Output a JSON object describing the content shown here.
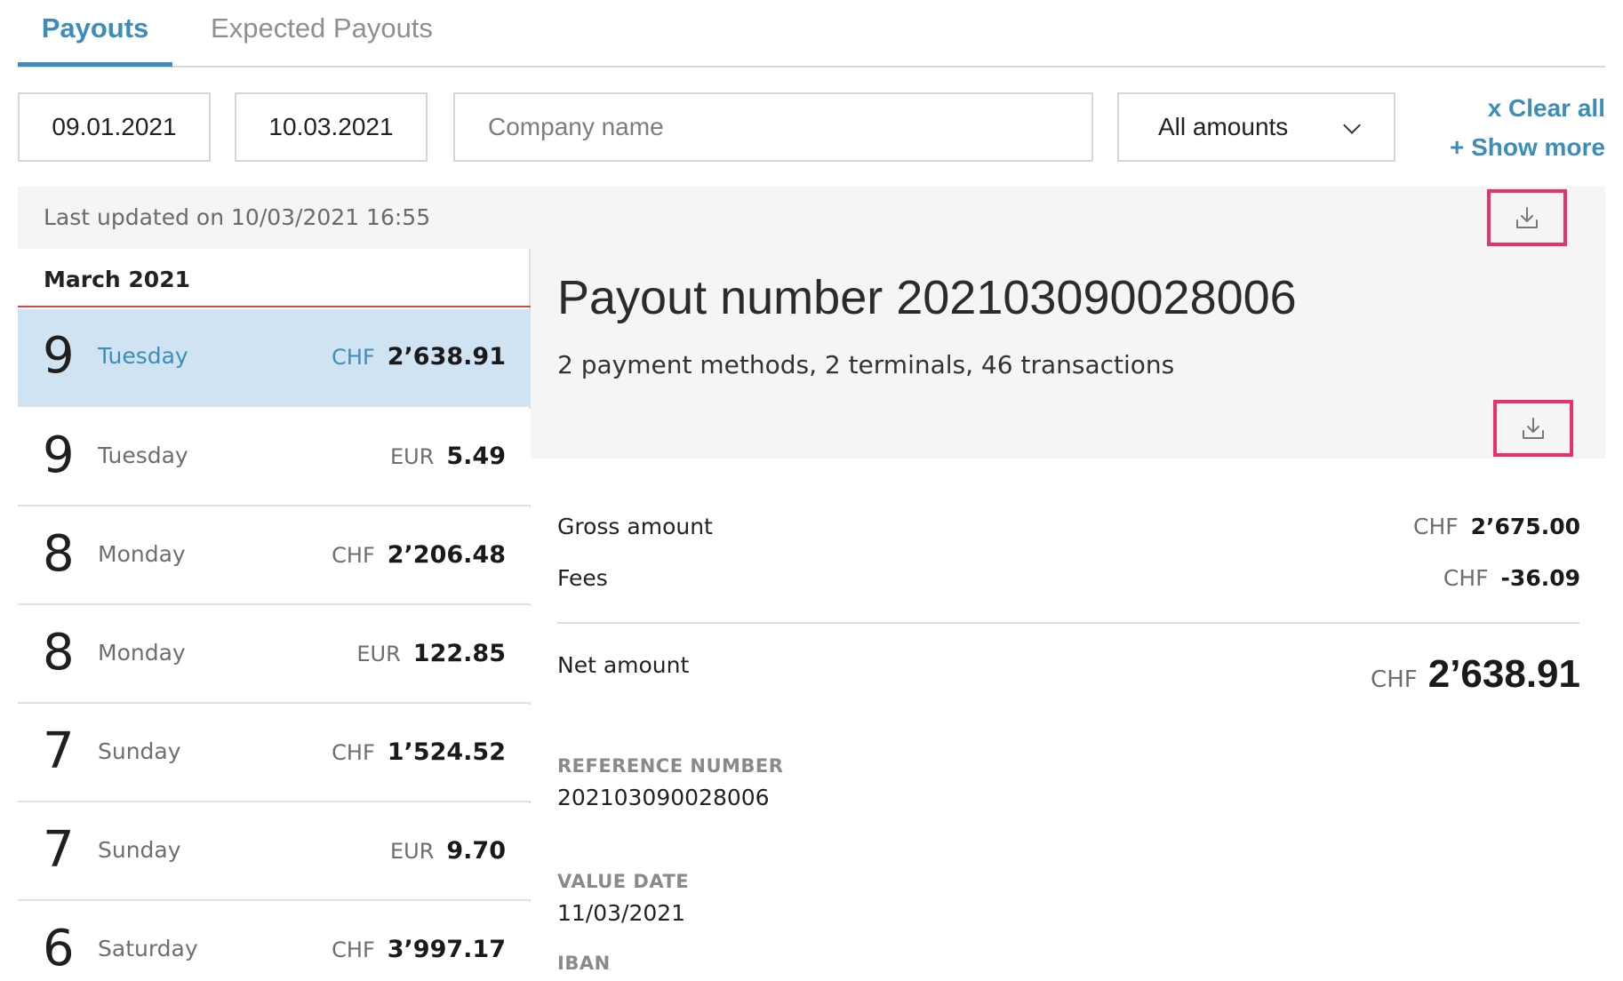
{
  "tabs": [
    {
      "label": "Payouts",
      "active": true
    },
    {
      "label": "Expected Payouts",
      "active": false
    }
  ],
  "filters": {
    "date_from": "09.01.2021",
    "date_to": "10.03.2021",
    "company_placeholder": "Company name",
    "amount_selected": "All amounts",
    "clear_all": "x Clear all",
    "show_more": "+ Show more"
  },
  "status": {
    "last_updated": "Last updated on 10/03/2021 16:55"
  },
  "payout_list": {
    "month": "March 2021",
    "rows": [
      {
        "day": "9",
        "weekday": "Tuesday",
        "currency": "CHF",
        "amount": "2’638.91",
        "selected": true
      },
      {
        "day": "9",
        "weekday": "Tuesday",
        "currency": "EUR",
        "amount": "5.49",
        "selected": false
      },
      {
        "day": "8",
        "weekday": "Monday",
        "currency": "CHF",
        "amount": "2’206.48",
        "selected": false
      },
      {
        "day": "8",
        "weekday": "Monday",
        "currency": "EUR",
        "amount": "122.85",
        "selected": false
      },
      {
        "day": "7",
        "weekday": "Sunday",
        "currency": "CHF",
        "amount": "1’524.52",
        "selected": false
      },
      {
        "day": "7",
        "weekday": "Sunday",
        "currency": "EUR",
        "amount": "9.70",
        "selected": false
      },
      {
        "day": "6",
        "weekday": "Saturday",
        "currency": "CHF",
        "amount": "3’997.17",
        "selected": false
      }
    ]
  },
  "detail": {
    "title": "Payout number 202103090028006",
    "subtitle": "2 payment methods, 2 terminals, 46 transactions",
    "gross": {
      "label": "Gross amount",
      "currency": "CHF",
      "value": "2’675.00"
    },
    "fees": {
      "label": "Fees",
      "currency": "CHF",
      "value": "-36.09"
    },
    "net": {
      "label": "Net amount",
      "currency": "CHF",
      "value": "2’638.91"
    },
    "reference": {
      "label": "REFERENCE NUMBER",
      "value": "202103090028006"
    },
    "value_date": {
      "label": "VALUE DATE",
      "value": "11/03/2021"
    },
    "iban": {
      "label": "IBAN"
    }
  },
  "icons": {
    "download": "download-icon",
    "chevron": "chevron-down-icon"
  },
  "colors": {
    "accent": "#3d8dbb",
    "highlight_border": "#e8336a",
    "month_underline": "#d74b3c",
    "selected_row": "#cfe3f2"
  }
}
